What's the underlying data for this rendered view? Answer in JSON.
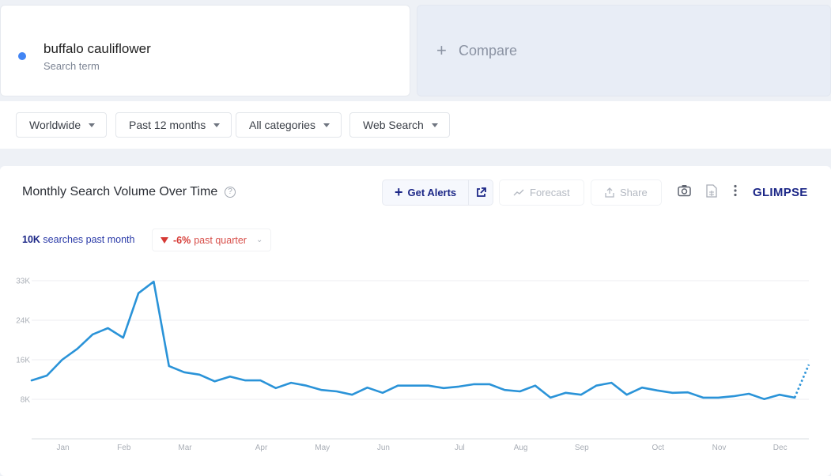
{
  "search_term": {
    "name": "buffalo cauliflower",
    "subtitle": "Search term",
    "color": "#4285f4"
  },
  "compare": {
    "icon": "plus-icon",
    "label": "Compare"
  },
  "filters": [
    {
      "label": "Worldwide",
      "icon": "caret-down-icon"
    },
    {
      "label": "Past 12 months",
      "icon": "caret-down-icon"
    },
    {
      "label": "All categories",
      "icon": "caret-down-icon"
    },
    {
      "label": "Web Search",
      "icon": "caret-down-icon"
    }
  ],
  "panel": {
    "title": "Monthly Search Volume Over Time",
    "help_icon": "question-circle-icon",
    "get_alerts_label": "Get Alerts",
    "forecast_label": "Forecast",
    "share_label": "Share",
    "brand": "GLIMPSE",
    "stats": {
      "volume_value": "10K",
      "volume_text": "searches past month",
      "change_value": "-6%",
      "change_text": "past quarter"
    },
    "colors": {
      "accent": "#1c2787",
      "line": "#2a93d8",
      "negative": "#d63a35"
    }
  },
  "chart_data": {
    "type": "line",
    "title": "Monthly Search Volume Over Time",
    "xlabel": "",
    "ylabel": "",
    "ylim": [
      0,
      33000
    ],
    "y_ticks": [
      {
        "label": "33K",
        "value": 33000
      },
      {
        "label": "24K",
        "value": 24750
      },
      {
        "label": "16K",
        "value": 16500
      },
      {
        "label": "8K",
        "value": 8250
      }
    ],
    "x_tick_labels": [
      {
        "label": "Jan",
        "index": 2
      },
      {
        "label": "Feb",
        "index": 6
      },
      {
        "label": "Mar",
        "index": 10
      },
      {
        "label": "Apr",
        "index": 15
      },
      {
        "label": "May",
        "index": 19
      },
      {
        "label": "Jun",
        "index": 23
      },
      {
        "label": "Jul",
        "index": 28
      },
      {
        "label": "Aug",
        "index": 32
      },
      {
        "label": "Sep",
        "index": 36
      },
      {
        "label": "Oct",
        "index": 41
      },
      {
        "label": "Nov",
        "index": 45
      },
      {
        "label": "Dec",
        "index": 49
      }
    ],
    "grid": true,
    "legend": "none",
    "series": [
      {
        "name": "buffalo cauliflower",
        "values": [
          12200,
          13200,
          16500,
          18800,
          21800,
          23100,
          21100,
          30400,
          32800,
          15200,
          13900,
          13400,
          12000,
          13000,
          12200,
          12200,
          10600,
          11700,
          11100,
          10200,
          9900,
          9200,
          10700,
          9600,
          11100,
          11100,
          11100,
          10600,
          10900,
          11400,
          11400,
          10200,
          9900,
          11100,
          8600,
          9600,
          9200,
          11100,
          11700,
          9200,
          10700,
          10100,
          9600,
          9700,
          8600,
          8600,
          8900,
          9400,
          8300,
          9200,
          8600
        ]
      },
      {
        "name": "forecast",
        "style": "dotted",
        "start_index": 50,
        "values": [
          8600,
          15500
        ]
      }
    ]
  }
}
